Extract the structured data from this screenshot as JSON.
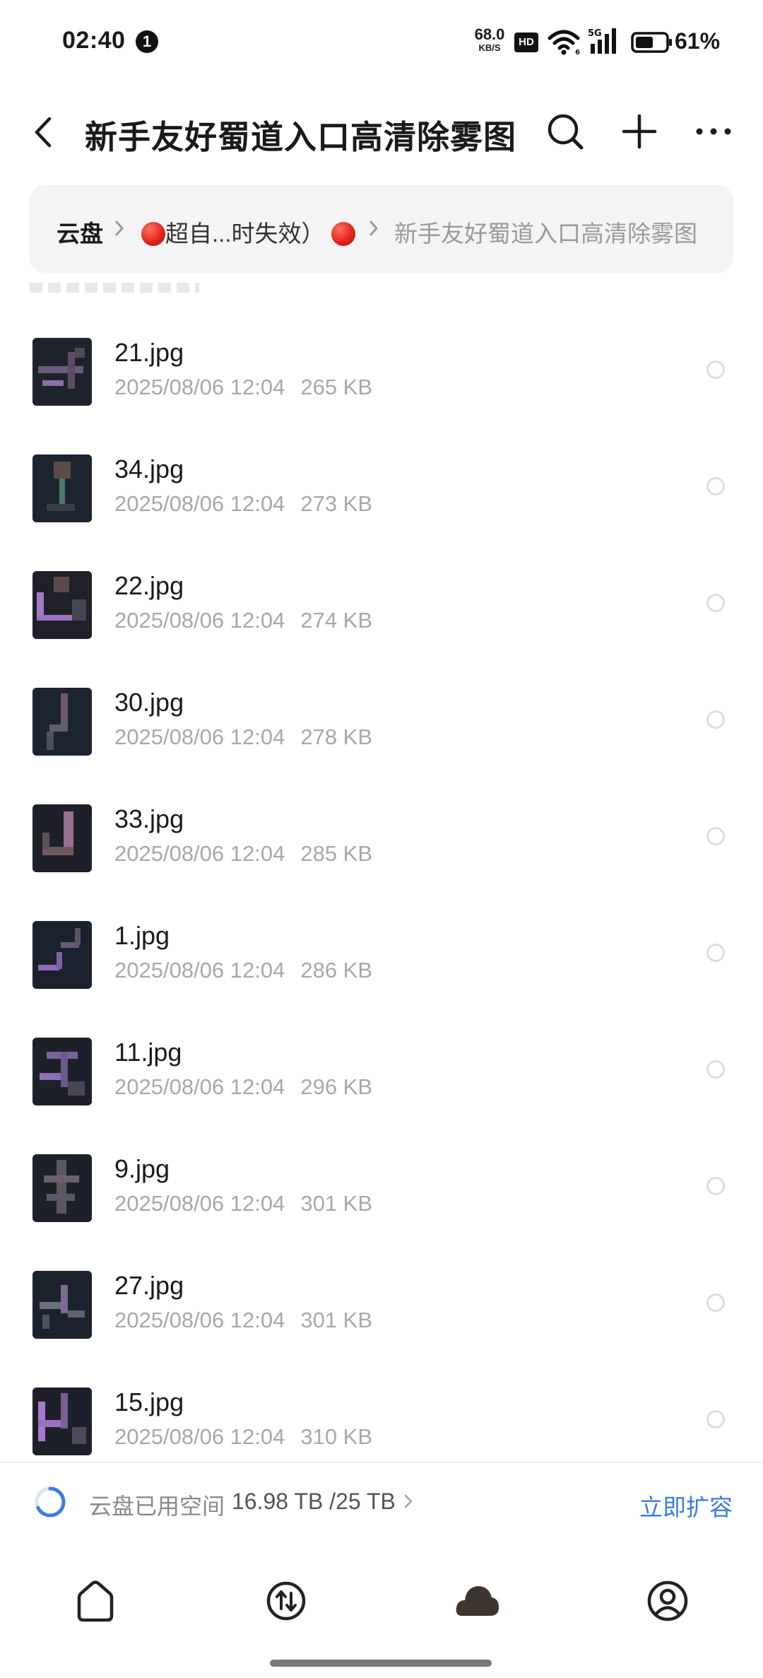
{
  "status_bar": {
    "time": "02:40",
    "notification_count": "1",
    "net_speed_value": "68.0",
    "net_speed_unit": "KB/S",
    "hd_label": "HD",
    "signal_label": "5G",
    "battery_percent": "61%",
    "battery_level": 0.61
  },
  "header": {
    "title": "新手友好蜀道入口高清除雾图"
  },
  "breadcrumb": {
    "root": "云盘",
    "middle": "超自...时失效）",
    "current": "新手友好蜀道入口高清除雾图"
  },
  "files": [
    {
      "name": "21.jpg",
      "date": "2025/08/06 12:04",
      "size": "265 KB"
    },
    {
      "name": "34.jpg",
      "date": "2025/08/06 12:04",
      "size": "273 KB"
    },
    {
      "name": "22.jpg",
      "date": "2025/08/06 12:04",
      "size": "274 KB"
    },
    {
      "name": "30.jpg",
      "date": "2025/08/06 12:04",
      "size": "278 KB"
    },
    {
      "name": "33.jpg",
      "date": "2025/08/06 12:04",
      "size": "285 KB"
    },
    {
      "name": "1.jpg",
      "date": "2025/08/06 12:04",
      "size": "286 KB"
    },
    {
      "name": "11.jpg",
      "date": "2025/08/06 12:04",
      "size": "296 KB"
    },
    {
      "name": "9.jpg",
      "date": "2025/08/06 12:04",
      "size": "301 KB"
    },
    {
      "name": "27.jpg",
      "date": "2025/08/06 12:04",
      "size": "301 KB"
    },
    {
      "name": "15.jpg",
      "date": "2025/08/06 12:04",
      "size": "310 KB"
    }
  ],
  "storage": {
    "label": "云盘已用空间",
    "value": "16.98 TB /25 TB",
    "used_fraction": 0.68,
    "expand_label": "立即扩容"
  },
  "colors": {
    "accent": "#3c7de0",
    "cloud_icon": "#3d3530",
    "breadcrumb_bg": "#f4f4f6"
  },
  "icons": {
    "nav": [
      "home-icon",
      "transfer-icon",
      "cloud-icon",
      "profile-icon"
    ]
  }
}
